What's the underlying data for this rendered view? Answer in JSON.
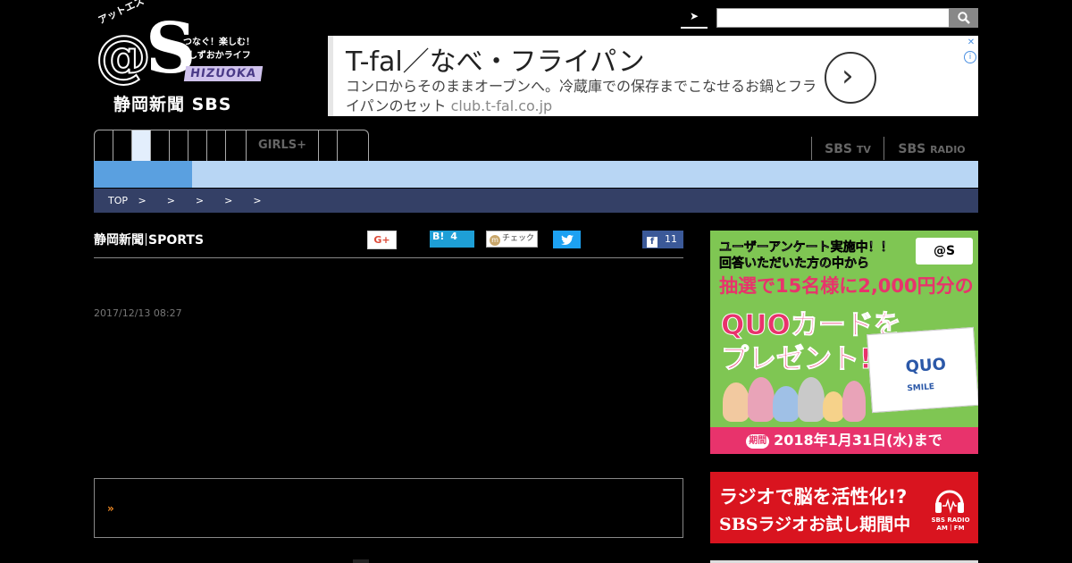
{
  "logo": {
    "katakana": "アットエス",
    "at": "@",
    "s": "S",
    "tagline1": "つなぐ！楽しむ！",
    "tagline2": "しずおかライフ",
    "hizuoka": "HIZUOKA",
    "wordmark": "静岡新聞 SBS"
  },
  "header": {
    "menu_glyph": "➤",
    "search_placeholder": ""
  },
  "ad": {
    "headline": "T-fal／なべ・フライパン",
    "body": "コンロからそのままオーブンへ。冷蔵庫での保存までこなせるお鍋とフライパンのセット",
    "url": "club.t-fal.co.jp",
    "arrow": "›",
    "close": "✕",
    "info": "i"
  },
  "nav": {
    "girls": "GIRLS+",
    "sbs_tv": "SBS",
    "sbs_tv_small": "TV",
    "sbs_radio": "SBS",
    "sbs_radio_small": "RADIO"
  },
  "breadcrumb": "TOP >  >  >  >  >",
  "article": {
    "source_a": "静岡新聞",
    "source_b": "SPORTS",
    "date": "2017/12/13 08:27"
  },
  "share": {
    "gplus": "G+",
    "hatena": "B!",
    "hatena_count": "4",
    "mixi_m": "m",
    "mixi": "チェック",
    "facebook_count": "11"
  },
  "related": {
    "arrow": "»"
  },
  "quo_banner": {
    "line1": "ユーザーアンケート実施中！！",
    "line2": "回答いただいた方の中から",
    "line3": "抽選で15名様に2,000円分の",
    "line4": "QUOカードを",
    "line5": "プレゼント!!",
    "card_title": "QUO",
    "card_smile": "SMILE",
    "logo": "@S",
    "period_tag": "期間",
    "period": "2018年1月31日(水)まで"
  },
  "radio_banner": {
    "line1": "ラジオで脳を活性化!?",
    "line2": "SBSラジオお試し期間中",
    "icon_label1": "SBS RADIO",
    "icon_label2": "AM｜FM"
  },
  "colors": {
    "subnav": "#b8d6f4",
    "subnav_active": "#5aa0e0",
    "breadcrumb": "#344066",
    "quo_green": "#7fc653",
    "quo_pink": "#e8336c",
    "radio_red": "#d9141f"
  }
}
